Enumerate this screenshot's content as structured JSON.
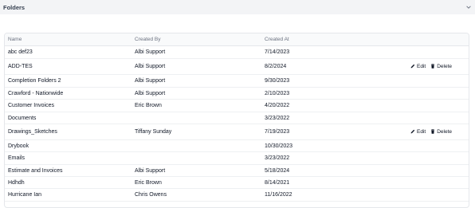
{
  "header": {
    "title": "Folders",
    "toggle_icon": "chevron-down-icon"
  },
  "table": {
    "columns": [
      "Name",
      "Created By",
      "Created At"
    ],
    "actions": {
      "edit": "Edit",
      "delete": "Delete"
    },
    "rows": [
      {
        "name": "abc def23",
        "created_by": "Albi Support",
        "created_at": "7/14/2023",
        "show_actions": false
      },
      {
        "name": "ADD-TES",
        "created_by": "Albi Support",
        "created_at": "8/2/2024",
        "show_actions": true
      },
      {
        "name": "Completion Folders 2",
        "created_by": "Albi Support",
        "created_at": "9/30/2023",
        "show_actions": false
      },
      {
        "name": "Crawford - Nationwide",
        "created_by": "Albi Support",
        "created_at": "2/10/2023",
        "show_actions": false
      },
      {
        "name": "Customer Invoices",
        "created_by": "Eric Brown",
        "created_at": "4/20/2022",
        "show_actions": false
      },
      {
        "name": "Documents",
        "created_by": "",
        "created_at": "3/23/2022",
        "show_actions": false
      },
      {
        "name": "Drawings_Sketches",
        "created_by": "Tiffany Sunday",
        "created_at": "7/19/2023",
        "show_actions": true
      },
      {
        "name": "Drybook",
        "created_by": "",
        "created_at": "10/30/2023",
        "show_actions": false
      },
      {
        "name": "Emails",
        "created_by": "",
        "created_at": "3/23/2022",
        "show_actions": false
      },
      {
        "name": "Estimate and Invoices",
        "created_by": "Albi Support",
        "created_at": "5/18/2024",
        "show_actions": false
      },
      {
        "name": "Hdhdh",
        "created_by": "Eric Brown",
        "created_at": "8/14/2021",
        "show_actions": false
      },
      {
        "name": "Hurricane Ian",
        "created_by": "Chris Owens",
        "created_at": "11/16/2022",
        "show_actions": false
      }
    ]
  }
}
